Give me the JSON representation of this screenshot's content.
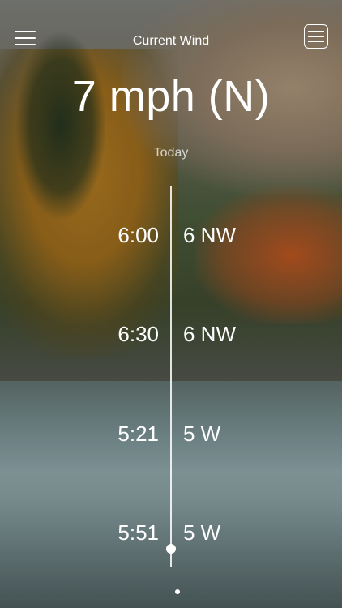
{
  "header": {
    "title": "Current Wind"
  },
  "current": {
    "speed": "7 mph (N)",
    "day_label": "Today"
  },
  "readings": [
    {
      "time": "6:00",
      "wind": "6 NW"
    },
    {
      "time": "6:30",
      "wind": "6 NW"
    },
    {
      "time": "5:21",
      "wind": "5 W"
    },
    {
      "time": "5:51",
      "wind": "5 W"
    }
  ],
  "icons": {
    "menu": "hamburger-menu-icon",
    "list": "list-icon"
  }
}
